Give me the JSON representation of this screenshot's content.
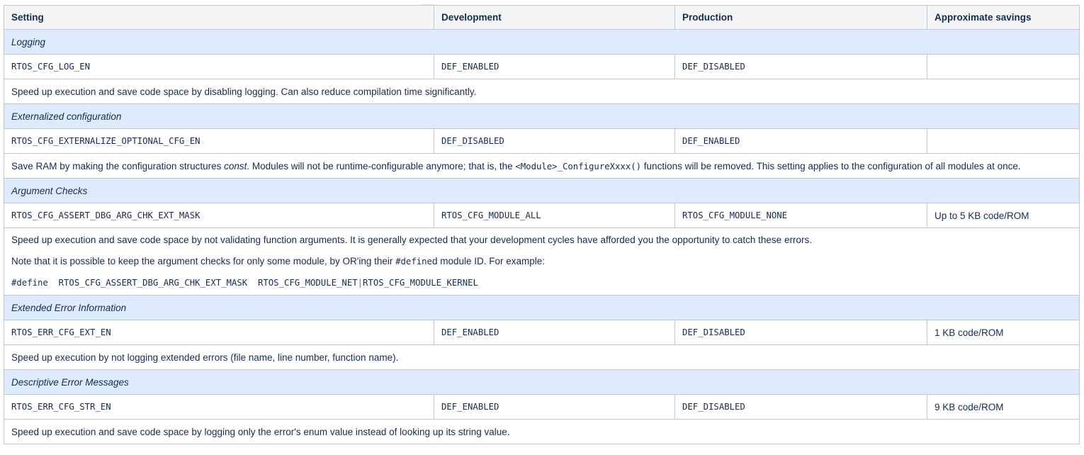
{
  "columns": [
    "Setting",
    "Development",
    "Production",
    "Approximate savings"
  ],
  "sections": [
    {
      "group": "Logging",
      "setting": "RTOS_CFG_LOG_EN",
      "development": "DEF_ENABLED",
      "production": "DEF_DISABLED",
      "savings": "",
      "description": "Speed up execution and save code space by disabling logging. Can also reduce compilation time significantly."
    },
    {
      "group": "Externalized configuration",
      "setting": "RTOS_CFG_EXTERNALIZE_OPTIONAL_CFG_EN",
      "development": "DEF_DISABLED",
      "production": "DEF_ENABLED",
      "savings": "",
      "description_parts": {
        "a": "Save RAM by making the configuration structures ",
        "b": "const",
        "c": ". Modules will not be runtime-configurable anymore; that is, the ",
        "d": "<Module>_ConfigureXxxx()",
        "e": " functions will be removed. This setting applies to the configuration of all modules at once."
      }
    },
    {
      "group": "Argument Checks",
      "setting": "RTOS_CFG_ASSERT_DBG_ARG_CHK_EXT_MASK",
      "development": "RTOS_CFG_MODULE_ALL",
      "production": "RTOS_CFG_MODULE_NONE",
      "savings": "Up to 5 KB code/ROM",
      "description_line1": "Speed up execution and save code space by not validating function arguments. It is generally expected that your development cycles have afforded you the opportunity to catch these errors.",
      "description_line2_parts": {
        "a": "Note that it is possible to keep the argument checks for only some module, by OR'ing their ",
        "b": "#define",
        "c": "d module ID. For example:"
      },
      "code_example": {
        "a": "#define  RTOS_CFG_ASSERT_DBG_ARG_CHK_EXT_MASK  RTOS_CFG_MODULE_NET",
        "sep": "|",
        "b": "RTOS_CFG_MODULE_KERNEL"
      }
    },
    {
      "group": "Extended Error Information",
      "setting": "RTOS_ERR_CFG_EXT_EN",
      "development": "DEF_ENABLED",
      "production": "DEF_DISABLED",
      "savings": "1 KB code/ROM",
      "description": "Speed up execution by not logging extended errors (file name, line number, function name)."
    },
    {
      "group": "Descriptive Error Messages",
      "setting": "RTOS_ERR_CFG_STR_EN",
      "development": "DEF_ENABLED",
      "production": "DEF_DISABLED",
      "savings": "9 KB code/ROM",
      "description": "Speed up execution and save code space by logging only the error's enum value instead of looking up its string value."
    }
  ]
}
